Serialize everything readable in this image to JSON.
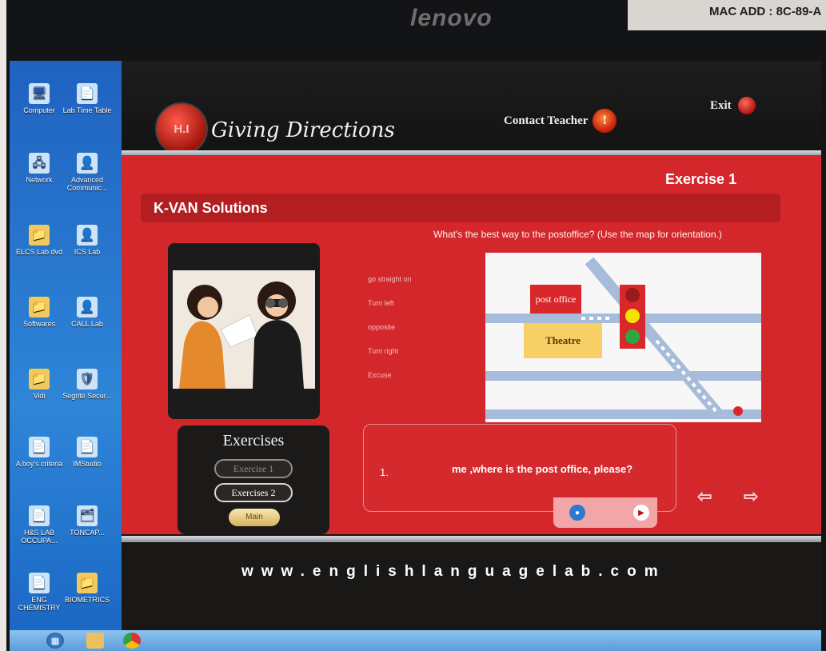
{
  "monitor": {
    "brand": "lenovo",
    "mac_label": "MAC ADD : 8C-89-A"
  },
  "desktop": {
    "icons": [
      {
        "label": "Computer",
        "glyph": "🖥"
      },
      {
        "label": "Lab Time Table",
        "glyph": "📄"
      },
      {
        "label": "Network",
        "glyph": "🖧"
      },
      {
        "label": "Advanced Communic...",
        "glyph": "👤"
      },
      {
        "label": "ELCS Lab dvd",
        "glyph": "📁"
      },
      {
        "label": "ICS Lab",
        "glyph": "👤"
      },
      {
        "label": "Softwares",
        "glyph": "📁"
      },
      {
        "label": "CALL Lab",
        "glyph": "👤"
      },
      {
        "label": "Vidi",
        "glyph": "📁"
      },
      {
        "label": "Segrite Secur...",
        "glyph": "🛡"
      },
      {
        "label": "A boy's criteria",
        "glyph": "📄"
      },
      {
        "label": "IMStudio",
        "glyph": "📄"
      },
      {
        "label": "H&S LAB OCCUPA...",
        "glyph": "📄"
      },
      {
        "label": "TONCAP...",
        "glyph": "🗂"
      },
      {
        "label": "ENG CHEMISTRY",
        "glyph": "📄"
      },
      {
        "label": "BIOMETRICS",
        "glyph": "📁"
      }
    ]
  },
  "app": {
    "logo_text": "H.I",
    "title": "Giving Directions",
    "contact_label": "Contact Teacher",
    "exit_label": "Exit",
    "exercise_heading": "Exercise 1",
    "company": "K-VAN Solutions",
    "question": "What's the best way to the postoffice?  (Use the map for orientation.)",
    "word_options": [
      "go straight on",
      "Turn left",
      "opposite",
      "Turn right",
      "Excuse"
    ],
    "map": {
      "post_office_label": "post office",
      "theatre_label": "Theatre"
    },
    "exercises": {
      "title": "Exercises",
      "items": [
        "Exercise 1",
        "Exercises 2"
      ],
      "main_label": "Main"
    },
    "answer": {
      "number": "1.",
      "text": "me ,where is the post office, please?"
    },
    "nav": {
      "prev": "⇦",
      "next": "⇨"
    },
    "footer_url": "www.englishlanguagelab.com"
  },
  "colors": {
    "panel_red": "#d3272b",
    "header_dark": "#161515",
    "desktop_blue": "#1f62c0"
  }
}
